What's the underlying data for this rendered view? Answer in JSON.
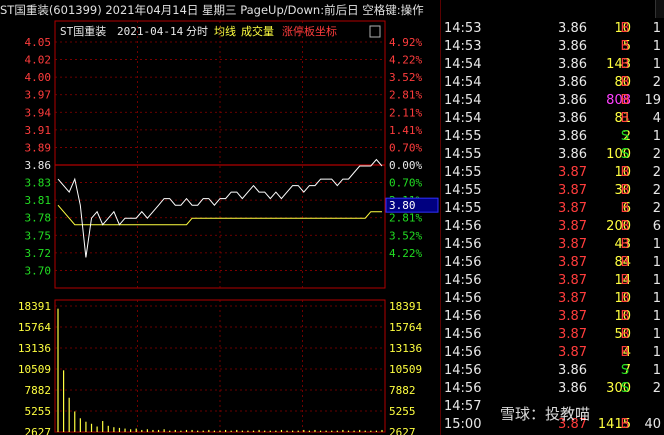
{
  "header": {
    "title": "ST国重装(601399)  2021年04月14日  星期三  PageUp/Down:前后日  空格键:操作"
  },
  "chart": {
    "name": "ST国重装",
    "date": "2021-04-14",
    "mode": "分时",
    "legend_avg": "均线",
    "legend_vol": "成交量",
    "legend_limit": "涨停板坐标",
    "current_price": "3.80"
  },
  "chart_data": {
    "type": "line",
    "prev_close": 3.86,
    "price_axis_left": [
      "4.05",
      "4.02",
      "4.00",
      "3.97",
      "3.94",
      "3.91",
      "3.89",
      "3.86",
      "3.83",
      "3.81",
      "3.78",
      "3.75",
      "3.72",
      "3.70"
    ],
    "percent_axis_right": [
      "4.92%",
      "4.22%",
      "3.52%",
      "2.81%",
      "2.11%",
      "1.41%",
      "0.70%",
      "0.00%",
      "0.70%",
      "2.11%",
      "2.81%",
      "3.52%",
      "4.22%"
    ],
    "volume_axis": [
      "18391",
      "15764",
      "13136",
      "10509",
      "7882",
      "5255",
      "2627"
    ],
    "ylim": [
      3.7,
      4.05
    ],
    "vol_max": 18391,
    "price_series": [
      3.84,
      3.83,
      3.82,
      3.84,
      3.8,
      3.72,
      3.78,
      3.79,
      3.77,
      3.78,
      3.79,
      3.77,
      3.78,
      3.78,
      3.78,
      3.79,
      3.78,
      3.79,
      3.8,
      3.81,
      3.81,
      3.8,
      3.8,
      3.81,
      3.8,
      3.8,
      3.81,
      3.81,
      3.8,
      3.81,
      3.81,
      3.82,
      3.82,
      3.81,
      3.82,
      3.83,
      3.82,
      3.82,
      3.81,
      3.82,
      3.81,
      3.82,
      3.83,
      3.83,
      3.82,
      3.83,
      3.83,
      3.84,
      3.84,
      3.84,
      3.83,
      3.84,
      3.84,
      3.85,
      3.86,
      3.86,
      3.86,
      3.87,
      3.86
    ],
    "avg_series": [
      3.8,
      3.79,
      3.78,
      3.77,
      3.77,
      3.77,
      3.77,
      3.77,
      3.77,
      3.77,
      3.77,
      3.77,
      3.77,
      3.77,
      3.77,
      3.77,
      3.77,
      3.77,
      3.77,
      3.77,
      3.77,
      3.77,
      3.77,
      3.77,
      3.78,
      3.78,
      3.78,
      3.78,
      3.78,
      3.78,
      3.78,
      3.78,
      3.78,
      3.78,
      3.78,
      3.78,
      3.78,
      3.78,
      3.78,
      3.78,
      3.78,
      3.78,
      3.78,
      3.78,
      3.78,
      3.78,
      3.78,
      3.78,
      3.78,
      3.78,
      3.78,
      3.78,
      3.78,
      3.78,
      3.78,
      3.78,
      3.79,
      3.79,
      3.79
    ],
    "volume_series": [
      18000,
      9000,
      5000,
      3000,
      2000,
      1500,
      1200,
      800,
      1600,
      900,
      700,
      600,
      500,
      400,
      500,
      300,
      400,
      300,
      300,
      400,
      200,
      300,
      200,
      300,
      300,
      200,
      200,
      300,
      200,
      200,
      300,
      200,
      300,
      200,
      200,
      200,
      300,
      200,
      200,
      200,
      300,
      200,
      200,
      200,
      300,
      200,
      300,
      200,
      200,
      200,
      200,
      300,
      200,
      200,
      300,
      200,
      200,
      200,
      300
    ]
  },
  "ticks": [
    {
      "time": "14:53",
      "price": "3.86",
      "pcolor": "white",
      "vol": "10",
      "vcolor": "yellow",
      "side": "B",
      "scolor": "red",
      "cnt": "1"
    },
    {
      "time": "14:53",
      "price": "3.86",
      "pcolor": "white",
      "vol": "5",
      "vcolor": "yellow",
      "side": "B",
      "scolor": "red",
      "cnt": "1"
    },
    {
      "time": "14:54",
      "price": "3.86",
      "pcolor": "white",
      "vol": "143",
      "vcolor": "yellow",
      "side": "B",
      "scolor": "red",
      "cnt": "1"
    },
    {
      "time": "14:54",
      "price": "3.86",
      "pcolor": "white",
      "vol": "80",
      "vcolor": "yellow",
      "side": "B",
      "scolor": "red",
      "cnt": "2"
    },
    {
      "time": "14:54",
      "price": "3.86",
      "pcolor": "white",
      "vol": "808",
      "vcolor": "magenta",
      "side": "B",
      "scolor": "red",
      "cnt": "19"
    },
    {
      "time": "14:54",
      "price": "3.86",
      "pcolor": "white",
      "vol": "81",
      "vcolor": "yellow",
      "side": "B",
      "scolor": "red",
      "cnt": "4"
    },
    {
      "time": "14:55",
      "price": "3.86",
      "pcolor": "white",
      "vol": "2",
      "vcolor": "yellow",
      "side": "S",
      "scolor": "green",
      "cnt": "1"
    },
    {
      "time": "14:55",
      "price": "3.86",
      "pcolor": "white",
      "vol": "100",
      "vcolor": "yellow",
      "side": "S",
      "scolor": "green",
      "cnt": "2"
    },
    {
      "time": "14:55",
      "price": "3.87",
      "pcolor": "red",
      "vol": "10",
      "vcolor": "yellow",
      "side": "B",
      "scolor": "red",
      "cnt": "2"
    },
    {
      "time": "14:55",
      "price": "3.87",
      "pcolor": "red",
      "vol": "30",
      "vcolor": "yellow",
      "side": "B",
      "scolor": "red",
      "cnt": "2"
    },
    {
      "time": "14:55",
      "price": "3.87",
      "pcolor": "red",
      "vol": "6",
      "vcolor": "yellow",
      "side": "B",
      "scolor": "red",
      "cnt": "2"
    },
    {
      "time": "14:56",
      "price": "3.87",
      "pcolor": "red",
      "vol": "200",
      "vcolor": "yellow",
      "side": "B",
      "scolor": "red",
      "cnt": "6"
    },
    {
      "time": "14:56",
      "price": "3.87",
      "pcolor": "red",
      "vol": "43",
      "vcolor": "yellow",
      "side": "B",
      "scolor": "red",
      "cnt": "1"
    },
    {
      "time": "14:56",
      "price": "3.87",
      "pcolor": "red",
      "vol": "84",
      "vcolor": "yellow",
      "side": "B",
      "scolor": "red",
      "cnt": "1"
    },
    {
      "time": "14:56",
      "price": "3.87",
      "pcolor": "red",
      "vol": "14",
      "vcolor": "yellow",
      "side": "B",
      "scolor": "red",
      "cnt": "1"
    },
    {
      "time": "14:56",
      "price": "3.87",
      "pcolor": "red",
      "vol": "10",
      "vcolor": "yellow",
      "side": "B",
      "scolor": "red",
      "cnt": "1"
    },
    {
      "time": "14:56",
      "price": "3.87",
      "pcolor": "red",
      "vol": "10",
      "vcolor": "yellow",
      "side": "B",
      "scolor": "red",
      "cnt": "1"
    },
    {
      "time": "14:56",
      "price": "3.87",
      "pcolor": "red",
      "vol": "50",
      "vcolor": "yellow",
      "side": "B",
      "scolor": "red",
      "cnt": "1"
    },
    {
      "time": "14:56",
      "price": "3.87",
      "pcolor": "red",
      "vol": "4",
      "vcolor": "yellow",
      "side": "B",
      "scolor": "red",
      "cnt": "1"
    },
    {
      "time": "14:56",
      "price": "3.86",
      "pcolor": "white",
      "vol": "7",
      "vcolor": "yellow",
      "side": "S",
      "scolor": "green",
      "cnt": "1"
    },
    {
      "time": "14:56",
      "price": "3.86",
      "pcolor": "white",
      "vol": "300",
      "vcolor": "yellow",
      "side": "S",
      "scolor": "green",
      "cnt": "2"
    },
    {
      "time": "14:57",
      "price": "",
      "pcolor": "white",
      "vol": "",
      "vcolor": "yellow",
      "side": "",
      "scolor": "red",
      "cnt": ""
    },
    {
      "time": "15:00",
      "price": "3.87",
      "pcolor": "red",
      "vol": "1415",
      "vcolor": "yellow",
      "side": "B",
      "scolor": "red",
      "cnt": "40"
    }
  ],
  "watermark": "雪球：投教喵",
  "colors": {
    "up": "#ff3c3c",
    "down": "#22dd22",
    "flat": "#e8e8e8",
    "price_line": "#ffffff",
    "avg_line": "#ffff40",
    "volume": "#ffff40",
    "grid": "#8b0000",
    "axis_frame": "#b00000",
    "current_box": "#000080"
  }
}
